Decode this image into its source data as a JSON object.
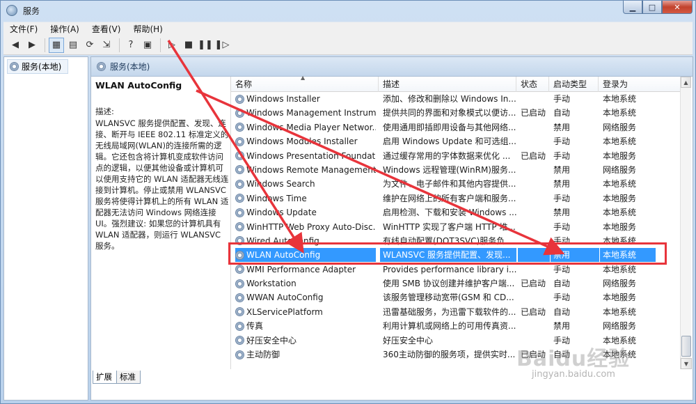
{
  "window": {
    "title": "服务",
    "controls": {
      "minimize": "▁",
      "maximize": "□",
      "close": "✕"
    }
  },
  "menubar": {
    "items": [
      "文件(F)",
      "操作(A)",
      "查看(V)",
      "帮助(H)"
    ]
  },
  "toolbar": {
    "icons": [
      "back-icon",
      "forward-icon",
      "console-tree-icon",
      "properties-icon",
      "refresh-icon",
      "export-icon",
      "help-icon",
      "view-icon",
      "play-icon",
      "stop-icon",
      "pause-icon",
      "restart-icon"
    ]
  },
  "tree": {
    "root_label": "服务(本地)"
  },
  "panel": {
    "header_label": "服务(本地)",
    "selected_service_title": "WLAN AutoConfig",
    "desc_label": "描述:",
    "desc_body": "WLANSVC 服务提供配置、发现、连接、断开与 IEEE 802.11 标准定义的无线局域网(WLAN)的连接所需的逻辑。它还包含将计算机变成软件访问点的逻辑，以便其他设备或计算机可以使用支持它的 WLAN 适配器无线连接到计算机。停止或禁用 WLANSVC 服务将使得计算机上的所有 WLAN 适配器无法访问 Windows 网络连接 UI。强烈建议: 如果您的计算机具有 WLAN 适配器，则运行 WLANSVC 服务。"
  },
  "table": {
    "columns": {
      "name": "名称",
      "desc": "描述",
      "status": "状态",
      "startup": "启动类型",
      "logon": "登录为"
    },
    "rows": [
      {
        "name": "Windows Installer",
        "desc": "添加、修改和删除以 Windows In...",
        "status": "",
        "startup": "手动",
        "logon": "本地系统"
      },
      {
        "name": "Windows Management Instrum...",
        "desc": "提供共同的界面和对象模式以便访...",
        "status": "已启动",
        "startup": "自动",
        "logon": "本地系统"
      },
      {
        "name": "Windows Media Player Networ...",
        "desc": "使用通用即插即用设备与其他网络...",
        "status": "",
        "startup": "禁用",
        "logon": "网络服务"
      },
      {
        "name": "Windows Modules Installer",
        "desc": "启用 Windows Update 和可选组...",
        "status": "",
        "startup": "手动",
        "logon": "本地系统"
      },
      {
        "name": "Windows Presentation Foundat...",
        "desc": "通过缓存常用的字体数据来优化 ...",
        "status": "已启动",
        "startup": "手动",
        "logon": "本地服务"
      },
      {
        "name": "Windows Remote Management...",
        "desc": "Windows 远程管理(WinRM)服务...",
        "status": "",
        "startup": "禁用",
        "logon": "网络服务"
      },
      {
        "name": "Windows Search",
        "desc": "为文件、电子邮件和其他内容提供...",
        "status": "",
        "startup": "禁用",
        "logon": "本地系统"
      },
      {
        "name": "Windows Time",
        "desc": "维护在网络上的所有客户端和服务...",
        "status": "",
        "startup": "手动",
        "logon": "本地服务"
      },
      {
        "name": "Windows Update",
        "desc": "启用检测、下载和安装 Windows ...",
        "status": "",
        "startup": "禁用",
        "logon": "本地系统"
      },
      {
        "name": "WinHTTP Web Proxy Auto-Disc...",
        "desc": "WinHTTP 实现了客户端 HTTP 堆...",
        "status": "",
        "startup": "手动",
        "logon": "本地服务"
      },
      {
        "name": "Wired AutoConfig",
        "desc": "有线自动配置(DOT3SVC)服务负...",
        "status": "",
        "startup": "手动",
        "logon": "本地系统"
      },
      {
        "name": "WLAN AutoConfig",
        "desc": "WLANSVC 服务提供配置、发现...",
        "status": "",
        "startup": "禁用",
        "logon": "本地系统",
        "selected": true
      },
      {
        "name": "WMI Performance Adapter",
        "desc": "Provides performance library i...",
        "status": "",
        "startup": "手动",
        "logon": "本地系统"
      },
      {
        "name": "Workstation",
        "desc": "使用 SMB 协议创建并维护客户端...",
        "status": "已启动",
        "startup": "自动",
        "logon": "网络服务"
      },
      {
        "name": "WWAN AutoConfig",
        "desc": "该服务管理移动宽带(GSM 和 CD...",
        "status": "",
        "startup": "手动",
        "logon": "本地服务"
      },
      {
        "name": "XLServicePlatform",
        "desc": "迅雷基础服务，为迅雷下载软件的...",
        "status": "已启动",
        "startup": "自动",
        "logon": "本地系统"
      },
      {
        "name": "传真",
        "desc": "利用计算机或网络上的可用传真资...",
        "status": "",
        "startup": "禁用",
        "logon": "网络服务"
      },
      {
        "name": "好压安全中心",
        "desc": "好压安全中心",
        "status": "",
        "startup": "手动",
        "logon": "本地系统"
      },
      {
        "name": "主动防御",
        "desc": "360主动防御的服务项，提供实时...",
        "status": "已启动",
        "startup": "自动",
        "logon": "本地系统"
      }
    ]
  },
  "tabs": [
    "扩展",
    "标准"
  ],
  "watermark": {
    "brand": "Baidu经验",
    "sub": "jingyan.baidu.com"
  },
  "colors": {
    "selection": "#3399ff",
    "highlight_box": "#e8343b"
  }
}
